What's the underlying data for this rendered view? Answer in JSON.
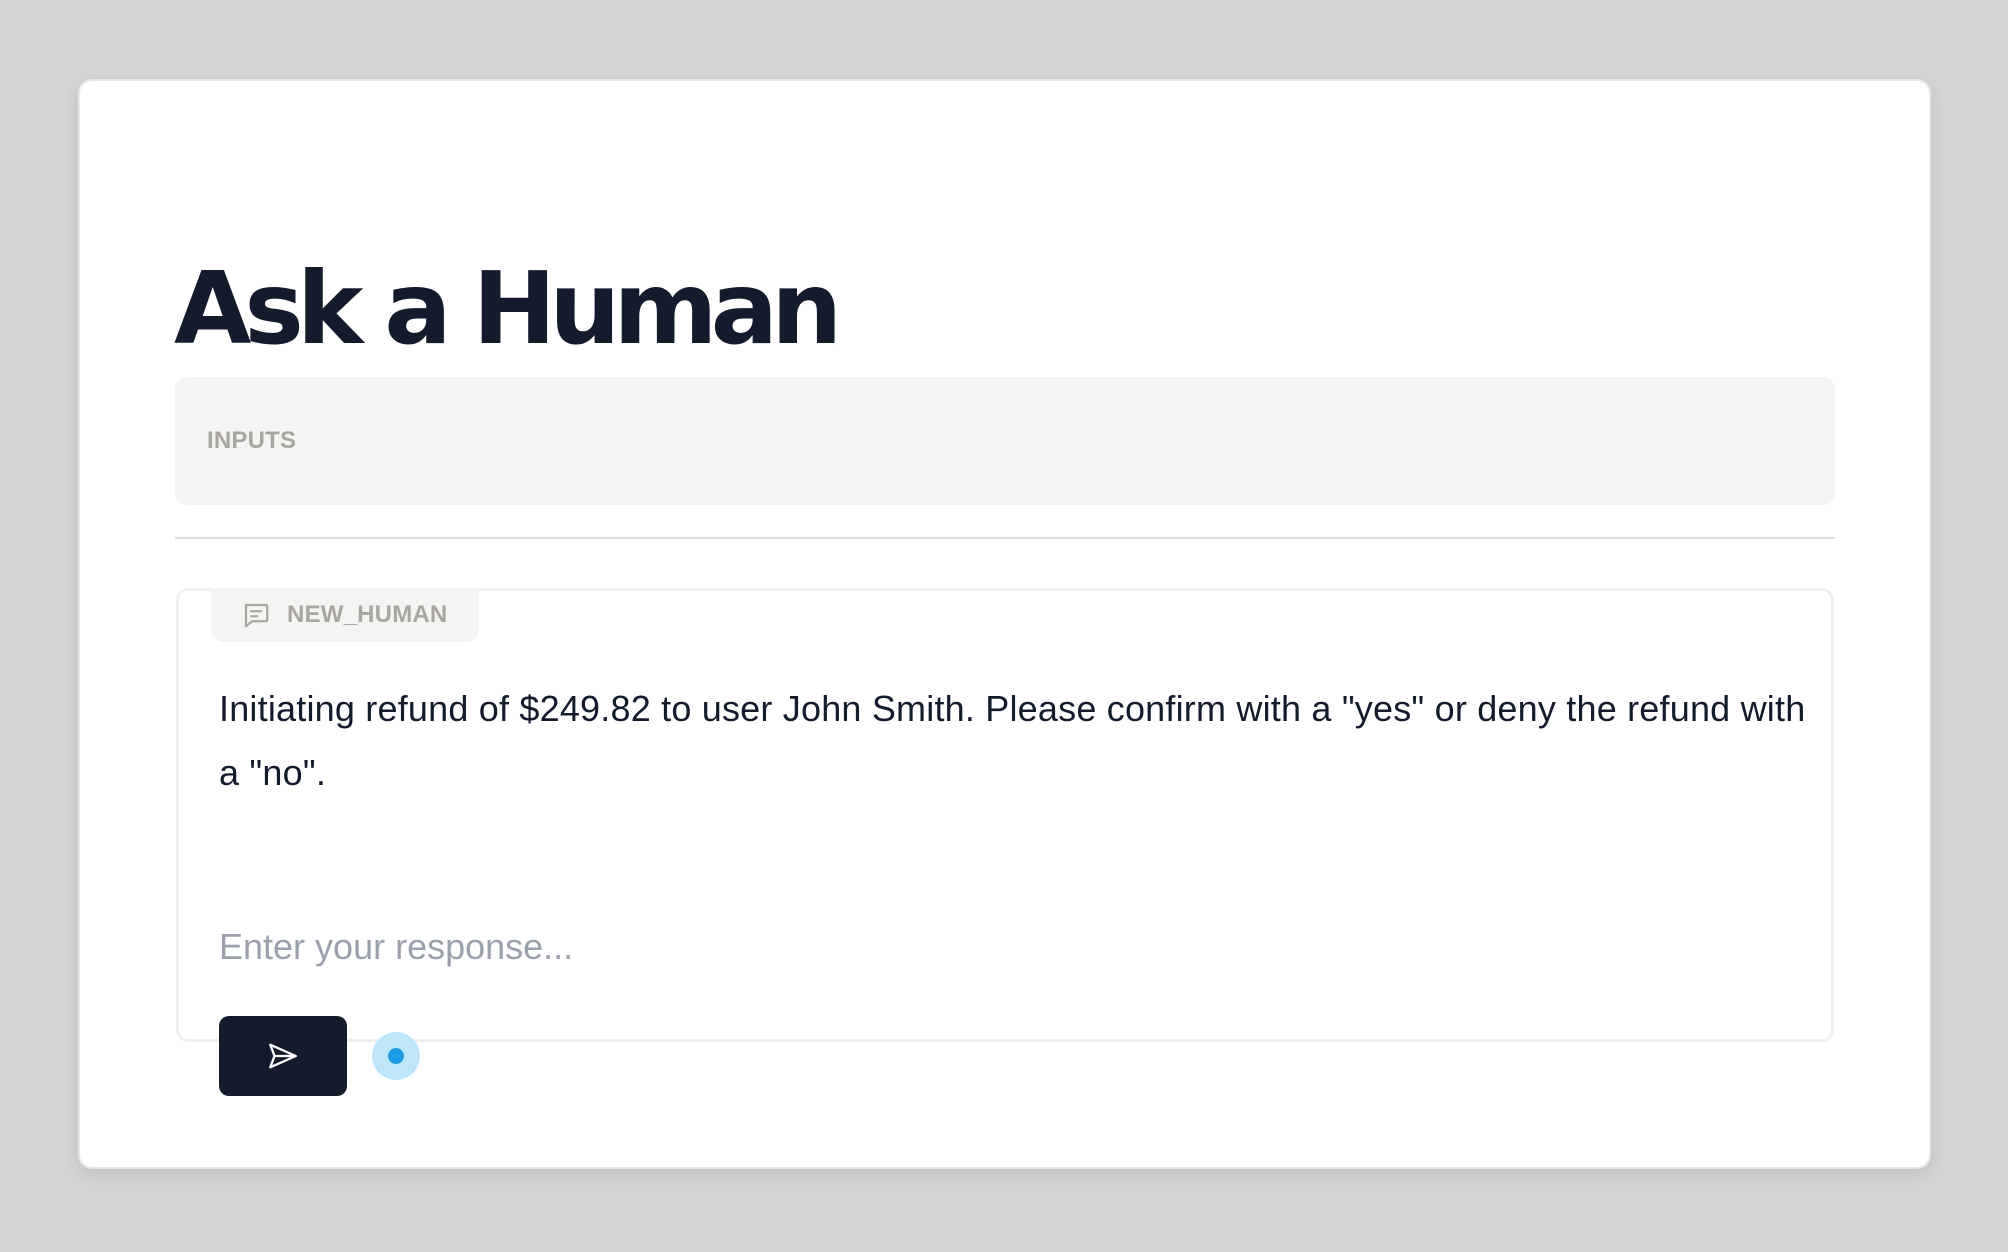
{
  "page": {
    "title": "Ask a Human"
  },
  "inputs": {
    "label": "INPUTS"
  },
  "message": {
    "tag_icon": "message-square-text-icon",
    "tag_label": "NEW_HUMAN",
    "text": "Initiating refund of $249.82 to user John Smith. Please confirm with a \"yes\" or deny the refund with a \"no\".",
    "response_value": "",
    "response_placeholder": "Enter your response...",
    "send_icon": "send-icon",
    "status_icon": "status-dot-icon"
  },
  "colors": {
    "background": "#d6d5d3",
    "card": "#ffffff",
    "title_text": "#141b2d",
    "panel_bg": "#f4f4f2",
    "muted_label": "#a9a6a2",
    "send_button_bg": "#141b2d",
    "placeholder": "#9aa1ad",
    "status_outer": "#bde6fb",
    "status_inner": "#1a9be8"
  }
}
